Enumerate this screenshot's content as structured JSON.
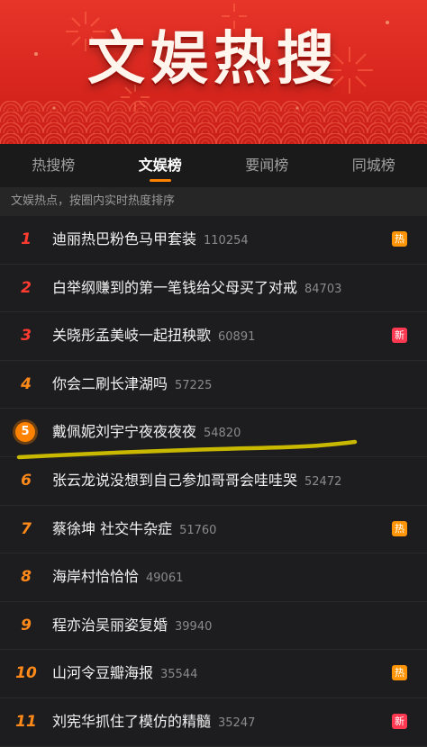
{
  "banner": {
    "title": "文娱热搜"
  },
  "tabs": [
    {
      "label": "热搜榜",
      "active": false
    },
    {
      "label": "文娱榜",
      "active": true
    },
    {
      "label": "要闻榜",
      "active": false
    },
    {
      "label": "同城榜",
      "active": false
    }
  ],
  "subtitle": "文娱热点，按圈内实时热度排序",
  "items": [
    {
      "rank": "1",
      "title": "迪丽热巴粉色马甲套装",
      "count": "110254",
      "tag": "热",
      "tag_type": "hot"
    },
    {
      "rank": "2",
      "title": "白举纲赚到的第一笔钱给父母买了对戒",
      "count": "84703",
      "tag": "",
      "tag_type": ""
    },
    {
      "rank": "3",
      "title": "关晓彤孟美岐一起扭秧歌",
      "count": "60891",
      "tag": "新",
      "tag_type": "new"
    },
    {
      "rank": "4",
      "title": "你会二刷长津湖吗",
      "count": "57225",
      "tag": "",
      "tag_type": ""
    },
    {
      "rank": "5",
      "title": "戴佩妮刘宇宁夜夜夜夜",
      "count": "54820",
      "tag": "",
      "tag_type": "",
      "highlighted": true
    },
    {
      "rank": "6",
      "title": "张云龙说没想到自己参加哥哥会哇哇哭",
      "count": "52472",
      "tag": "",
      "tag_type": ""
    },
    {
      "rank": "7",
      "title": "蔡徐坤 社交牛杂症",
      "count": "51760",
      "tag": "热",
      "tag_type": "hot"
    },
    {
      "rank": "8",
      "title": "海岸村恰恰恰",
      "count": "49061",
      "tag": "",
      "tag_type": ""
    },
    {
      "rank": "9",
      "title": "程亦治吴丽姿复婚",
      "count": "39940",
      "tag": "",
      "tag_type": ""
    },
    {
      "rank": "10",
      "title": "山河令豆瓣海报",
      "count": "35544",
      "tag": "热",
      "tag_type": "hot"
    },
    {
      "rank": "11",
      "title": "刘宪华抓住了模仿的精髓",
      "count": "35247",
      "tag": "新",
      "tag_type": "new"
    }
  ],
  "colors": {
    "banner": "#d9271f",
    "tab_indicator": "#ff8200",
    "rank_top": "#ff3b30",
    "rank_normal": "#ff8a1a",
    "tag_hot": "#ff9406",
    "tag_new": "#ff3852",
    "underline_annotation": "#c9b800"
  }
}
